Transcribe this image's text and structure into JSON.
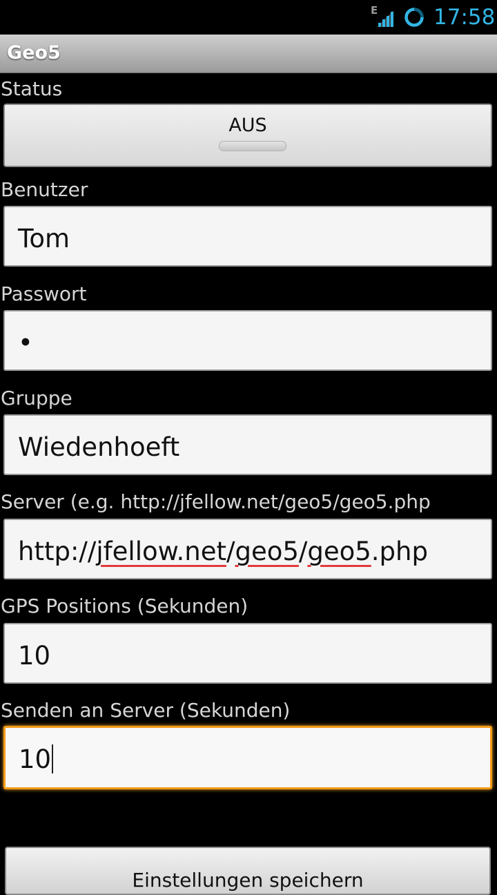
{
  "status_bar": {
    "network_type": "E",
    "time": "17:58",
    "icons": [
      "signal-icon",
      "sync-icon"
    ],
    "clock_color": "#33b5e5"
  },
  "app": {
    "title": "Geo5"
  },
  "form": {
    "status": {
      "label": "Status",
      "toggle_text": "AUS",
      "is_on": false
    },
    "benutzer": {
      "label": "Benutzer",
      "value": "Tom"
    },
    "passwort": {
      "label": "Passwort",
      "value": "•"
    },
    "gruppe": {
      "label": "Gruppe",
      "value": "Wiedenhoeft"
    },
    "server": {
      "label": "Server (e.g. http://jfellow.net/geo5/geo5.php",
      "value_prefix": "http://",
      "value_part1": "jfellow.net",
      "value_sep1": "/",
      "value_part2": "geo5",
      "value_sep2": "/",
      "value_part3": "geo5",
      "value_suffix": ".php"
    },
    "gps_interval": {
      "label": "GPS Positions (Sekunden)",
      "value": "10"
    },
    "send_interval": {
      "label": "Senden an Server (Sekunden)",
      "value": "10",
      "focused": true
    },
    "save_button": {
      "label": "Einstellungen speichern"
    }
  },
  "colors": {
    "background": "#000000",
    "focus": "#f39b17",
    "spellcheck": "#e23a3a"
  }
}
